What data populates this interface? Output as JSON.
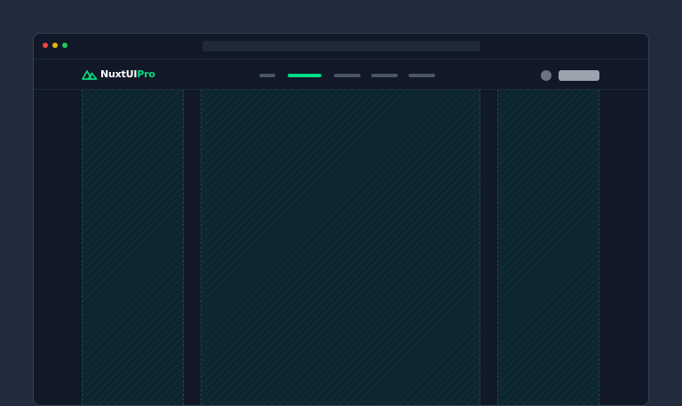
{
  "browser": {
    "dots": [
      {
        "name": "close",
        "color": "#ef4444"
      },
      {
        "name": "minimize",
        "color": "#eab308"
      },
      {
        "name": "maximize",
        "color": "#22c55e"
      }
    ]
  },
  "header": {
    "logo": {
      "text": "NuxtUI",
      "suffix": "Pro",
      "icon": "nuxt-mountain-icon",
      "accent": "#00dc82"
    },
    "nav_links": [
      {
        "name": "nav-link-1",
        "active": false
      },
      {
        "name": "nav-link-2",
        "active": true
      },
      {
        "name": "nav-link-3",
        "active": false
      },
      {
        "name": "nav-link-4",
        "active": false
      },
      {
        "name": "nav-link-5",
        "active": false
      }
    ]
  },
  "layout": {
    "columns": [
      "left-sidebar",
      "main-content",
      "right-sidebar"
    ]
  }
}
